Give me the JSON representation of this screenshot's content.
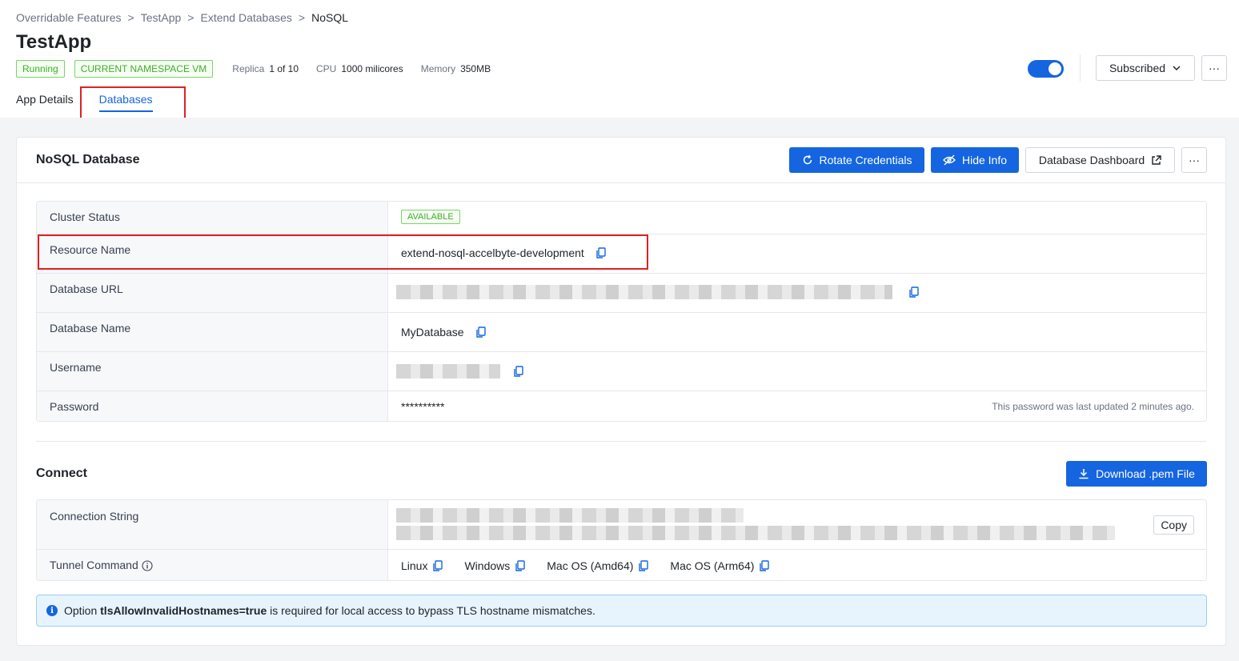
{
  "breadcrumb": [
    "Overridable Features",
    "TestApp",
    "Extend Databases",
    "NoSQL"
  ],
  "page_title": "TestApp",
  "status_tags": {
    "running": "Running",
    "namespace": "CURRENT NAMESPACE VM"
  },
  "meta": {
    "replica_label": "Replica",
    "replica_value": "1 of 10",
    "cpu_label": "CPU",
    "cpu_value": "1000 milicores",
    "memory_label": "Memory",
    "memory_value": "350MB"
  },
  "header_actions": {
    "subscribed_label": "Subscribed",
    "more": "···",
    "toggle_on": true
  },
  "tabs": [
    {
      "label": "App Details",
      "active": false
    },
    {
      "label": "Databases",
      "active": true
    }
  ],
  "card": {
    "title": "NoSQL Database",
    "rotate_label": "Rotate Credentials",
    "hide_label": "Hide Info",
    "dashboard_label": "Database Dashboard",
    "more": "···"
  },
  "details": {
    "cluster_status_label": "Cluster Status",
    "cluster_status_value": "AVAILABLE",
    "resource_name_label": "Resource Name",
    "resource_name_value": "extend-nosql-accelbyte-development",
    "database_url_label": "Database URL",
    "database_name_label": "Database Name",
    "database_name_value": "MyDatabase",
    "username_label": "Username",
    "password_label": "Password",
    "password_value": "**********",
    "password_hint": "This password was last updated 2 minutes ago."
  },
  "connect": {
    "title": "Connect",
    "download_label": "Download .pem File",
    "connection_string_label": "Connection String",
    "copy_label": "Copy",
    "tunnel_command_label": "Tunnel Command",
    "os_options": [
      "Linux",
      "Windows",
      "Mac OS (Amd64)",
      "Mac OS (Arm64)"
    ]
  },
  "info": {
    "prefix": "Option",
    "option": "tlsAllowInvalidHostnames=true",
    "suffix": "is required for local access to bypass TLS hostname mismatches."
  },
  "colors": {
    "primary": "#1565e0",
    "success": "#3fae2a",
    "highlight": "#e02020"
  }
}
